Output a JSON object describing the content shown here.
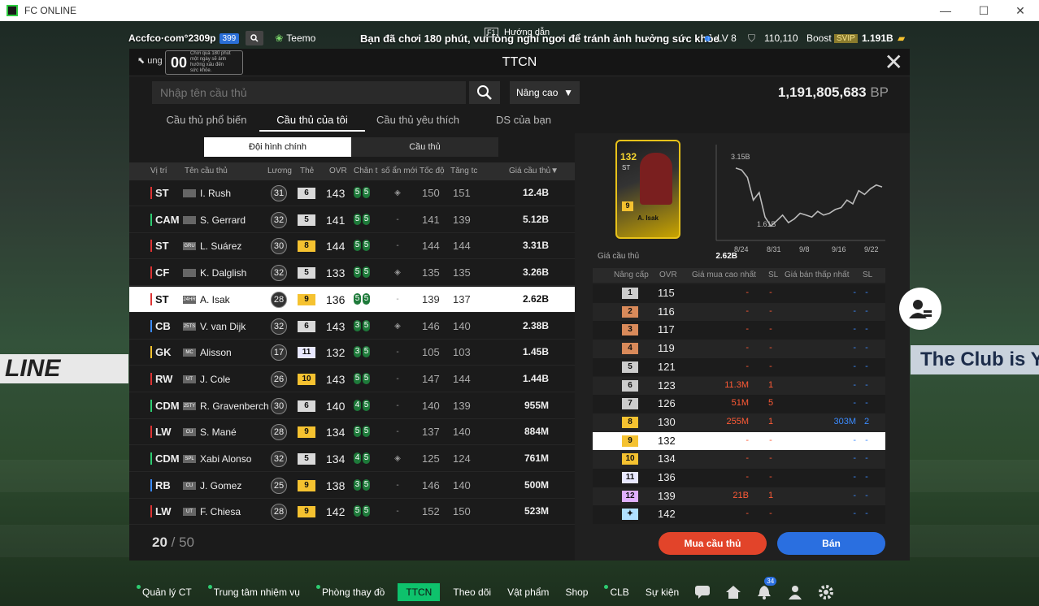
{
  "window": {
    "title": "FC ONLINE",
    "minimize": "—",
    "maximize": "☐",
    "close": "✕"
  },
  "topbar": {
    "account": "Accfco·com°2309p",
    "account_badge": "399",
    "friend": "Teemo",
    "notice": "Bạn đã chơi 180 phút, vui lòng nghỉ ngơi để tránh ảnh hưởng sức khỏe",
    "guide": "Hướng dẫn",
    "guide_key": "F1",
    "level": "LV 8",
    "points": "110,110",
    "boost": "Boost",
    "boost_badge": "SVIP",
    "bp": "1.191B"
  },
  "panel": {
    "title": "TTCN",
    "back_label": "ung tâm",
    "timer": "00",
    "timer_note": "Chơi quá 180 phút một ngày sẽ ảnh hưởng xấu đến sức khỏe.",
    "search_placeholder": "Nhập tên cầu thủ",
    "advanced": "Nâng cao",
    "bp_value": "1,191,805,683",
    "bp_unit": "BP",
    "tabs": [
      "Cầu thủ phổ biến",
      "Cầu thủ của tôi",
      "Cầu thủ yêu thích",
      "DS của bạn"
    ],
    "subtabs": [
      "Đội hình chính",
      "Cầu thủ"
    ],
    "columns": [
      "Vị trí",
      "Tên cầu thủ",
      "Lương",
      "Thẻ",
      "OVR",
      "Chân t",
      "số ẩn mới",
      "Tốc độ",
      "Tăng tc",
      "Giá cầu thủ▼"
    ],
    "players": [
      {
        "pos": "ST",
        "season": "",
        "name": "I. Rush",
        "wage": "31",
        "lv": "6",
        "ovr": "143",
        "f1": "5",
        "f2": "5",
        "spd": "150",
        "acc": "151",
        "price": "12.4B"
      },
      {
        "pos": "CAM",
        "season": "",
        "name": "S. Gerrard",
        "wage": "32",
        "lv": "5",
        "ovr": "141",
        "f1": "5",
        "f2": "5",
        "spd": "141",
        "acc": "139",
        "price": "5.12B"
      },
      {
        "pos": "ST",
        "season": "GRU",
        "name": "L. Suárez",
        "wage": "30",
        "lv": "8",
        "ovr": "144",
        "f1": "5",
        "f2": "5",
        "spd": "144",
        "acc": "144",
        "price": "3.31B"
      },
      {
        "pos": "CF",
        "season": "",
        "name": "K. Dalglish",
        "wage": "32",
        "lv": "5",
        "ovr": "133",
        "f1": "5",
        "f2": "5",
        "spd": "135",
        "acc": "135",
        "price": "3.26B"
      },
      {
        "pos": "ST",
        "season": "24HR",
        "name": "A. Isak",
        "wage": "28",
        "lv": "9",
        "ovr": "136",
        "f1": "5",
        "f2": "5",
        "spd": "139",
        "acc": "137",
        "price": "2.62B"
      },
      {
        "pos": "CB",
        "season": "25TS",
        "name": "V. van Dijk",
        "wage": "32",
        "lv": "6",
        "ovr": "143",
        "f1": "3",
        "f2": "5",
        "spd": "146",
        "acc": "140",
        "price": "2.38B"
      },
      {
        "pos": "GK",
        "season": "MC",
        "name": "Alisson",
        "wage": "17",
        "lv": "11",
        "ovr": "132",
        "f1": "3",
        "f2": "5",
        "spd": "105",
        "acc": "103",
        "price": "1.45B"
      },
      {
        "pos": "RW",
        "season": "UT",
        "name": "J. Cole",
        "wage": "26",
        "lv": "10",
        "ovr": "143",
        "f1": "5",
        "f2": "5",
        "spd": "147",
        "acc": "144",
        "price": "1.44B"
      },
      {
        "pos": "CDM",
        "season": "25TY",
        "name": "R. Gravenberch",
        "wage": "30",
        "lv": "6",
        "ovr": "140",
        "f1": "4",
        "f2": "5",
        "spd": "140",
        "acc": "139",
        "price": "955M"
      },
      {
        "pos": "LW",
        "season": "CU",
        "name": "S. Mané",
        "wage": "28",
        "lv": "9",
        "ovr": "134",
        "f1": "5",
        "f2": "5",
        "spd": "137",
        "acc": "140",
        "price": "884M"
      },
      {
        "pos": "CDM",
        "season": "SPL",
        "name": "Xabi Alonso",
        "wage": "32",
        "lv": "5",
        "ovr": "134",
        "f1": "4",
        "f2": "5",
        "spd": "125",
        "acc": "124",
        "price": "761M"
      },
      {
        "pos": "RB",
        "season": "CU",
        "name": "J. Gomez",
        "wage": "25",
        "lv": "9",
        "ovr": "138",
        "f1": "3",
        "f2": "5",
        "spd": "146",
        "acc": "140",
        "price": "500M"
      },
      {
        "pos": "LW",
        "season": "UT",
        "name": "F. Chiesa",
        "wage": "28",
        "lv": "9",
        "ovr": "142",
        "f1": "5",
        "f2": "5",
        "spd": "152",
        "acc": "150",
        "price": "523M"
      }
    ],
    "count_current": "20",
    "count_total": "/ 50",
    "card": {
      "ovr": "132",
      "pos": "ST",
      "name": "A. Isak",
      "lv": "9"
    },
    "card_price_label": "Giá cầu thủ",
    "card_price_value": "2.62B",
    "price_table_headers": [
      "Nâng cấp",
      "OVR",
      "Giá mua cao nhất",
      "SL",
      "Giá bán thấp nhất",
      "SL"
    ],
    "price_rows": [
      {
        "lv": "1",
        "ovr": "115",
        "bh": "-",
        "bq": "-",
        "sl": "-",
        "sq": "-"
      },
      {
        "lv": "2",
        "ovr": "116",
        "bh": "-",
        "bq": "-",
        "sl": "-",
        "sq": "-"
      },
      {
        "lv": "3",
        "ovr": "117",
        "bh": "-",
        "bq": "-",
        "sl": "-",
        "sq": "-"
      },
      {
        "lv": "4",
        "ovr": "119",
        "bh": "-",
        "bq": "-",
        "sl": "-",
        "sq": "-"
      },
      {
        "lv": "5",
        "ovr": "121",
        "bh": "-",
        "bq": "-",
        "sl": "-",
        "sq": "-"
      },
      {
        "lv": "6",
        "ovr": "123",
        "bh": "11.3M",
        "bq": "1",
        "sl": "-",
        "sq": "-"
      },
      {
        "lv": "7",
        "ovr": "126",
        "bh": "51M",
        "bq": "5",
        "sl": "-",
        "sq": "-"
      },
      {
        "lv": "8",
        "ovr": "130",
        "bh": "255M",
        "bq": "1",
        "sl": "303M",
        "sq": "2"
      },
      {
        "lv": "9",
        "ovr": "132",
        "bh": "-",
        "bq": "-",
        "sl": "-",
        "sq": "-"
      },
      {
        "lv": "10",
        "ovr": "134",
        "bh": "-",
        "bq": "-",
        "sl": "-",
        "sq": "-"
      },
      {
        "lv": "11",
        "ovr": "136",
        "bh": "-",
        "bq": "-",
        "sl": "-",
        "sq": "-"
      },
      {
        "lv": "12",
        "ovr": "139",
        "bh": "21B",
        "bq": "1",
        "sl": "-",
        "sq": "-"
      },
      {
        "lv": "✦",
        "ovr": "142",
        "bh": "-",
        "bq": "-",
        "sl": "-",
        "sq": "-"
      }
    ],
    "buy": "Mua cầu thủ",
    "sell": "Bán"
  },
  "chart_data": {
    "type": "line",
    "x": [
      "8/24",
      "8/31",
      "9/8",
      "9/16",
      "9/22"
    ],
    "ylabels": [
      "3.15B",
      "1.61B"
    ],
    "series": [
      {
        "values": [
          3.15,
          3.1,
          2.9,
          2.3,
          2.5,
          1.85,
          1.61,
          1.75,
          1.9,
          1.7,
          1.8,
          1.95,
          1.9,
          1.85,
          2.0,
          1.9,
          1.95,
          2.05,
          2.1,
          2.3,
          2.2,
          2.55,
          2.45,
          2.6,
          2.7,
          2.65
        ]
      }
    ]
  },
  "bottom_nav": [
    "Quản lý CT",
    "Trung tâm nhiệm vụ",
    "Phòng thay đồ",
    "TTCN",
    "Theo dõi",
    "Vật phẩm",
    "Shop",
    "CLB",
    "Sự kiện"
  ],
  "notif_count": "34",
  "ads": {
    "left": "LINE",
    "right": "The Club is Y"
  },
  "colors": {
    "accent_green": "#0ec26c",
    "buy": "#e2442a",
    "sell": "#2a6fe0"
  }
}
